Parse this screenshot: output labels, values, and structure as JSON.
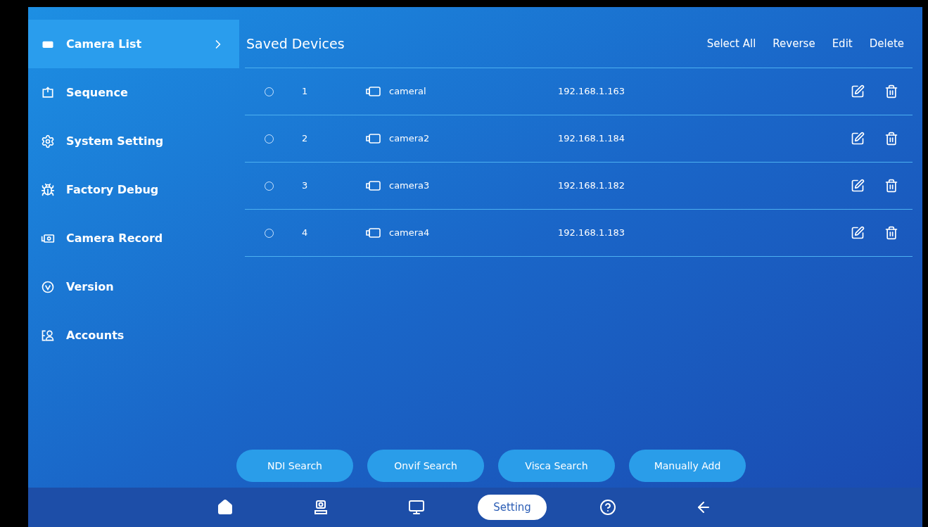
{
  "sidebar": {
    "items": [
      {
        "kind": "camera",
        "label": "Camera List",
        "selected": true
      },
      {
        "kind": "sequence",
        "label": "Sequence",
        "selected": false
      },
      {
        "kind": "gear",
        "label": "System Setting",
        "selected": false
      },
      {
        "kind": "bug",
        "label": "Factory Debug",
        "selected": false
      },
      {
        "kind": "record",
        "label": "Camera Record",
        "selected": false
      },
      {
        "kind": "version",
        "label": "Version",
        "selected": false
      },
      {
        "kind": "accounts",
        "label": "Accounts",
        "selected": false
      }
    ]
  },
  "panel": {
    "title": "Saved Devices",
    "actions": [
      "Select All",
      "Reverse",
      "Edit",
      "Delete"
    ]
  },
  "devices": [
    {
      "selected": false,
      "index": "1",
      "name": "cameral",
      "ip": "192.168.1.163"
    },
    {
      "selected": false,
      "index": "2",
      "name": "camera2",
      "ip": "192.168.1.184"
    },
    {
      "selected": false,
      "index": "3",
      "name": "camera3",
      "ip": "192.168.1.182"
    },
    {
      "selected": false,
      "index": "4",
      "name": "camera4",
      "ip": "192.168.1.183"
    }
  ],
  "buttons": [
    "NDI Search",
    "Onvif Search",
    "Visca Search",
    "Manually Add"
  ],
  "nav": [
    {
      "kind": "home",
      "selected": false
    },
    {
      "kind": "ptz",
      "selected": false
    },
    {
      "kind": "monitor",
      "selected": false
    },
    {
      "kind": "label",
      "label": "Setting",
      "selected": true
    },
    {
      "kind": "help",
      "selected": false
    },
    {
      "kind": "back",
      "selected": false
    }
  ]
}
